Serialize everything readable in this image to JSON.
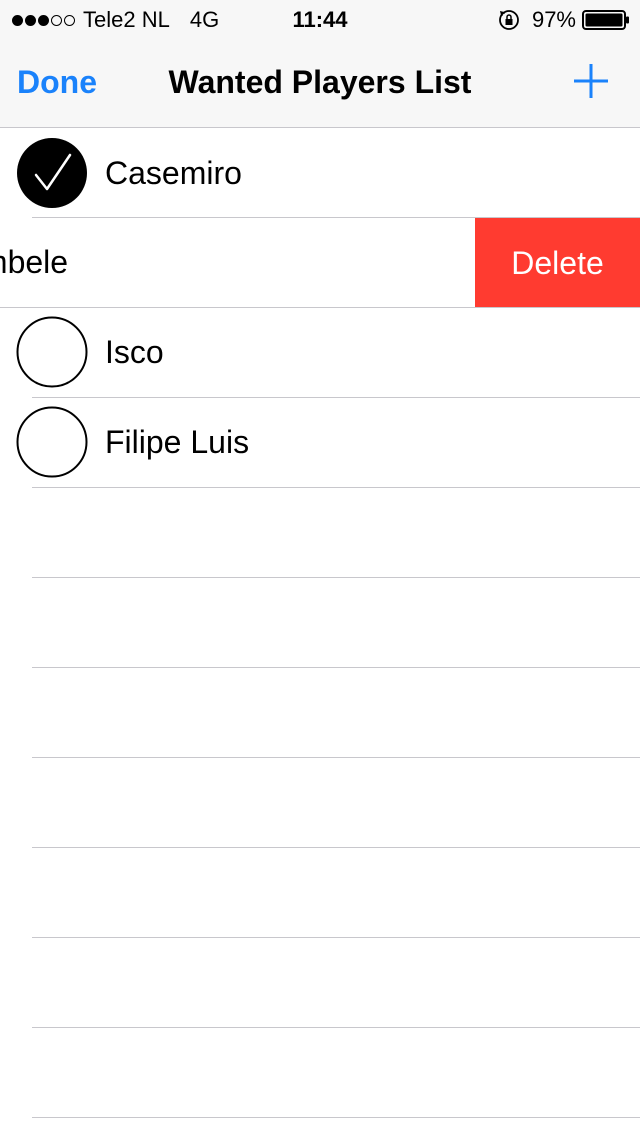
{
  "status_bar": {
    "carrier": "Tele2 NL",
    "network": "4G",
    "time": "11:44",
    "battery": "97%",
    "signal_bars_filled": 3,
    "signal_bars_total": 5
  },
  "nav": {
    "done_label": "Done",
    "title": "Wanted Players List",
    "add_icon": "plus-icon"
  },
  "colors": {
    "accent": "#1a82fb",
    "delete": "#ff3b30",
    "separator": "#c8c7cc"
  },
  "players": [
    {
      "name": "Casemiro",
      "checked": true
    },
    {
      "name": "Dembele",
      "checked": false,
      "swiped": true
    },
    {
      "name": "Isco",
      "checked": false
    },
    {
      "name": "Filipe Luis",
      "checked": false
    }
  ],
  "swipe_action": {
    "delete_label": "Delete"
  }
}
